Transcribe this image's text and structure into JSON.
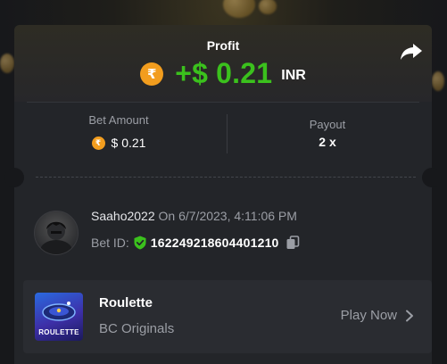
{
  "colors": {
    "profit_green": "#3bc11d",
    "coin_orange": "#f29d1e",
    "shield_green": "#3bc11d",
    "card_bg": "#232529",
    "muted_text": "#9b9ea5"
  },
  "profit": {
    "title": "Profit",
    "coin_symbol": "₹",
    "amount": "+$ 0.21",
    "currency": "INR"
  },
  "stats": {
    "bet_amount": {
      "label": "Bet Amount",
      "coin_symbol": "₹",
      "value": "$ 0.21"
    },
    "payout": {
      "label": "Payout",
      "value": "2 x"
    }
  },
  "bet_info": {
    "username": "Saaho2022",
    "date_text": "On 6/7/2023, 4:11:06 PM",
    "bet_id_label": "Bet ID:",
    "bet_id": "162249218604401210"
  },
  "game": {
    "title": "Roulette",
    "thumb_label": "ROULETTE",
    "provider": "BC Originals",
    "play_label": "Play Now"
  },
  "icons": [
    "share-icon",
    "rupee-coin-icon",
    "shield-check-icon",
    "copy-icon",
    "chevron-right-icon",
    "user-avatar"
  ]
}
